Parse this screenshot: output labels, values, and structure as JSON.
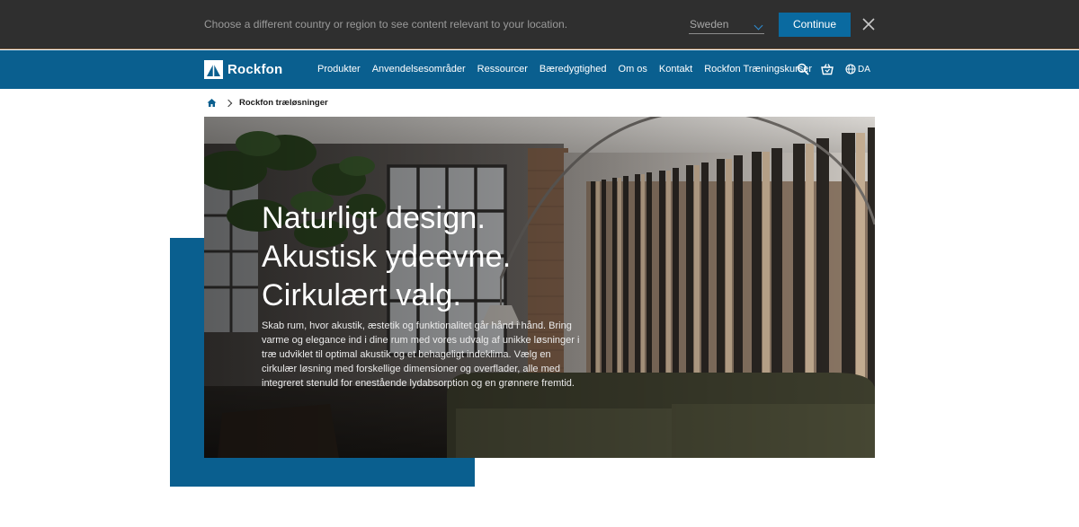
{
  "region_bar": {
    "message": "Choose a different country or region to see content relevant to your location.",
    "selected_country": "Sweden",
    "continue_label": "Continue",
    "close_icon": "close-icon"
  },
  "nav": {
    "logo_text": "Rockfon",
    "items": [
      {
        "label": "Produkter"
      },
      {
        "label": "Anvendelsesområder"
      },
      {
        "label": "Ressourcer"
      },
      {
        "label": "Bæredygtighed"
      },
      {
        "label": "Om os"
      },
      {
        "label": "Kontakt"
      },
      {
        "label": "Rockfon Træningskurser"
      }
    ],
    "language": "DA",
    "icons": [
      "search-icon",
      "basket-icon",
      "globe-icon"
    ]
  },
  "breadcrumb": {
    "home_icon": "home-icon",
    "current": "Rockfon træløsninger"
  },
  "hero": {
    "title_lines": [
      "Naturligt design.",
      "Akustisk ydeevne.",
      "Cirkulært valg."
    ],
    "body": "Skab rum, hvor akustik, æstetik og funktionalitet går hånd i hånd. Bring varme og elegance ind i dine rum med vores udvalg af unikke løsninger i træ udviklet til optimal akustik og et behageligt indeklima. Vælg en cirkulær løsning med forskellige dimensioner og overflader, alle med integreret stenuld for enestående lydabsorption og en grønnere fremtid."
  },
  "colors": {
    "brand_blue": "#0a5f8f",
    "button_blue": "#0a6aa0",
    "region_bar_bg": "#2f2f2f"
  }
}
